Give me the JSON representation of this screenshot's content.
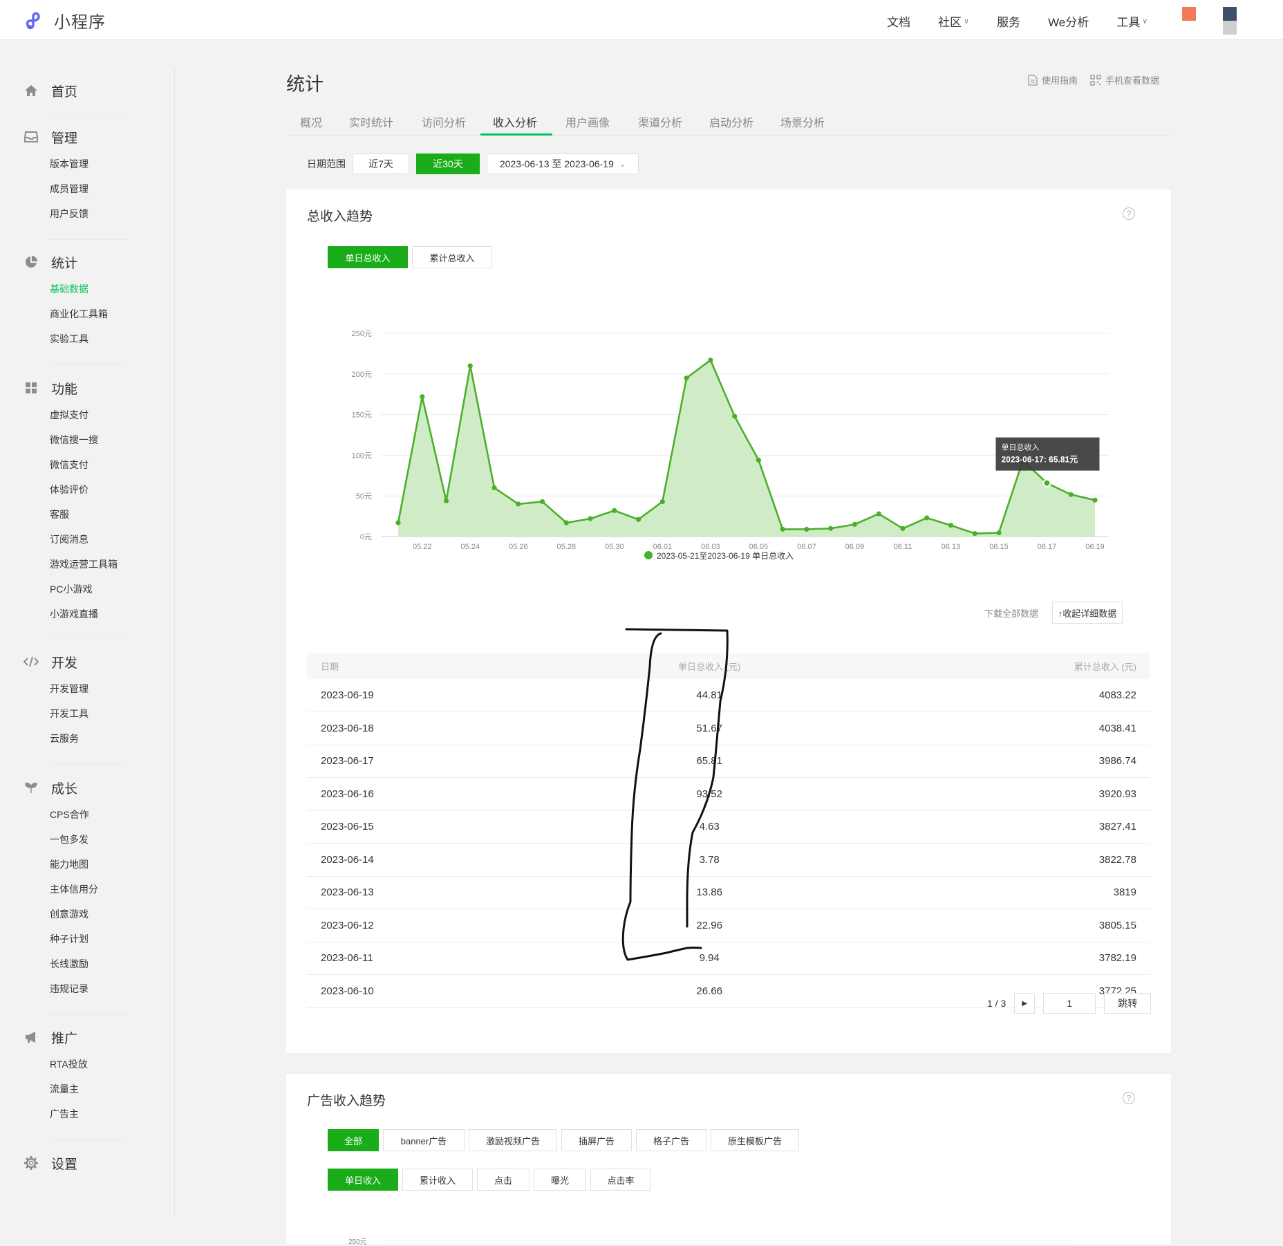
{
  "app": {
    "title": "小程序"
  },
  "topnav": [
    {
      "label": "文档",
      "chevron": false
    },
    {
      "label": "社区",
      "chevron": true
    },
    {
      "label": "服务",
      "chevron": false
    },
    {
      "label": "We分析",
      "chevron": false
    },
    {
      "label": "工具",
      "chevron": true
    }
  ],
  "sidebar": {
    "home": "首页",
    "manage": {
      "label": "管理",
      "items": [
        "版本管理",
        "成员管理",
        "用户反馈"
      ]
    },
    "stats": {
      "label": "统计",
      "items": [
        "基础数据",
        "商业化工具箱",
        "实验工具"
      ],
      "active": "基础数据"
    },
    "features": {
      "label": "功能",
      "items": [
        "虚拟支付",
        "微信搜一搜",
        "微信支付",
        "体验评价",
        "客服",
        "订阅消息",
        "游戏运营工具箱",
        "PC小游戏",
        "小游戏直播"
      ]
    },
    "dev": {
      "label": "开发",
      "items": [
        "开发管理",
        "开发工具",
        "云服务"
      ]
    },
    "growth": {
      "label": "成长",
      "items": [
        "CPS合作",
        "一包多发",
        "能力地图",
        "主体信用分",
        "创意游戏",
        "种子计划",
        "长线激励",
        "违规记录"
      ]
    },
    "promo": {
      "label": "推广",
      "items": [
        "RTA投放",
        "流量主",
        "广告主"
      ]
    },
    "settings": "设置"
  },
  "main": {
    "title": "统计",
    "helpers": {
      "guide": "使用指南",
      "mobile": "手机查看数据"
    },
    "tabs": [
      "概况",
      "实时统计",
      "访问分析",
      "收入分析",
      "用户画像",
      "渠道分析",
      "启动分析",
      "场景分析"
    ],
    "active_tab": "收入分析",
    "date": {
      "label": "日期范围",
      "opt7": "近7天",
      "opt30": "近30天",
      "range": "2023-06-13 至 2023-06-19"
    }
  },
  "revenue": {
    "title": "总收入趋势",
    "toggle": [
      "单日总收入",
      "累计总收入"
    ],
    "legend": "2023-05-21至2023-06-19 单日总收入",
    "tooltip": {
      "title": "单日总收入",
      "value": "2023-06-17: 65.81元"
    },
    "actions": {
      "download": "下载全部数据",
      "collapse": "↑收起详细数据"
    },
    "table": {
      "headers": [
        "日期",
        "单日总收入 (元)",
        "累计总收入 (元)"
      ],
      "rows": [
        [
          "2023-06-19",
          "44.81",
          "4083.22"
        ],
        [
          "2023-06-18",
          "51.67",
          "4038.41"
        ],
        [
          "2023-06-17",
          "65.81",
          "3986.74"
        ],
        [
          "2023-06-16",
          "93.52",
          "3920.93"
        ],
        [
          "2023-06-15",
          "4.63",
          "3827.41"
        ],
        [
          "2023-06-14",
          "3.78",
          "3822.78"
        ],
        [
          "2023-06-13",
          "13.86",
          "3819"
        ],
        [
          "2023-06-12",
          "22.96",
          "3805.15"
        ],
        [
          "2023-06-11",
          "9.94",
          "3782.19"
        ],
        [
          "2023-06-10",
          "26.66",
          "3772.25"
        ]
      ]
    },
    "pager": {
      "text": "1 / 3",
      "input": "1",
      "jump": "跳转"
    }
  },
  "ad": {
    "title": "广告收入趋势",
    "types": [
      "全部",
      "banner广告",
      "激励视频广告",
      "插屏广告",
      "格子广告",
      "原生模板广告"
    ],
    "metrics": [
      "单日收入",
      "累计收入",
      "点击",
      "曝光",
      "点击率"
    ],
    "y_first": "250元"
  },
  "chart_data": {
    "type": "area",
    "x": [
      "05.21",
      "05.22",
      "05.23",
      "05.24",
      "05.25",
      "05.26",
      "05.27",
      "05.28",
      "05.29",
      "05.30",
      "05.31",
      "06.01",
      "06.02",
      "06.03",
      "06.04",
      "06.05",
      "06.06",
      "06.07",
      "06.08",
      "06.09",
      "06.10",
      "06.11",
      "06.12",
      "06.13",
      "06.14",
      "06.15",
      "06.16",
      "06.17",
      "06.18",
      "06.19"
    ],
    "x_ticks": [
      "05.22",
      "05.24",
      "05.26",
      "05.28",
      "05.30",
      "06.01",
      "06.03",
      "06.05",
      "06.07",
      "06.09",
      "06.11",
      "06.13",
      "06.15",
      "06.17",
      "06.19"
    ],
    "series": [
      {
        "name": "2023-05-21至2023-06-19 单日总收入",
        "values": [
          17,
          172,
          44,
          210,
          60,
          40,
          43,
          17,
          22,
          32,
          21,
          43,
          195,
          217,
          148,
          94,
          9,
          9,
          10,
          15,
          28,
          9.94,
          22.96,
          13.86,
          3.78,
          4.63,
          93.52,
          65.81,
          51.67,
          44.81
        ]
      }
    ],
    "yticks": [
      "250元",
      "200元",
      "150元",
      "100元",
      "50元",
      "0元"
    ],
    "ylim": [
      0,
      250
    ],
    "color": "#4caf2c"
  },
  "colors": {
    "accent": "#07c160",
    "button_green": "#1aad19",
    "line": "#4caf2c"
  }
}
